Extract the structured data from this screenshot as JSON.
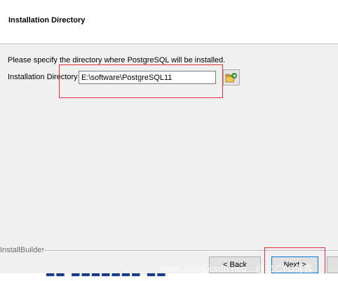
{
  "header": {
    "title": "Installation Directory"
  },
  "main": {
    "instruction": "Please specify the directory where PostgreSQL will be installed.",
    "directory_label": "Installation Directory",
    "directory_value": "E:\\software\\PostgreSQL11",
    "browse_icon": "folder-open-icon"
  },
  "footer": {
    "brand": "InstallBuilder",
    "back_label": "< Back",
    "next_label": "Next >"
  },
  "overlay": {
    "watermark": "https://blog.csdn.net/...@51CTO博客",
    "highlight_color": "#e0303a"
  }
}
